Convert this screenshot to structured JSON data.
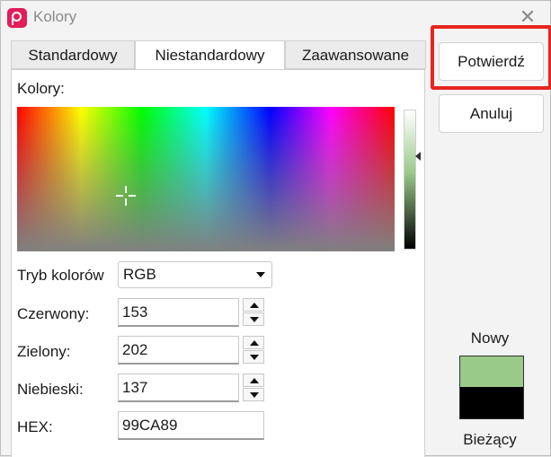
{
  "window": {
    "title": "Kolory",
    "app_icon": "app-logo-icon",
    "close_icon": "close-icon",
    "close_glyph": "✕"
  },
  "tabs": [
    {
      "label": "Standardowy",
      "active": false
    },
    {
      "label": "Niestandardowy",
      "active": true
    },
    {
      "label": "Zaawansowane",
      "active": false
    }
  ],
  "colors_label": "Kolory:",
  "color_mode": {
    "label": "Tryb kolorów",
    "value": "RGB"
  },
  "channels": {
    "red": {
      "label": "Czerwony:",
      "value": "153"
    },
    "green": {
      "label": "Zielony:",
      "value": "202"
    },
    "blue": {
      "label": "Niebieski:",
      "value": "137"
    }
  },
  "hex": {
    "label": "HEX:",
    "value": "99CA89"
  },
  "buttons": {
    "confirm": "Potwierdź",
    "cancel": "Anuluj"
  },
  "preview": {
    "new_label": "Nowy",
    "current_label": "Bieżący",
    "new_color": "#99CA89",
    "current_color": "#000000"
  },
  "colors": {
    "highlight": "#E8241E",
    "app_icon": "#E01E5A"
  }
}
